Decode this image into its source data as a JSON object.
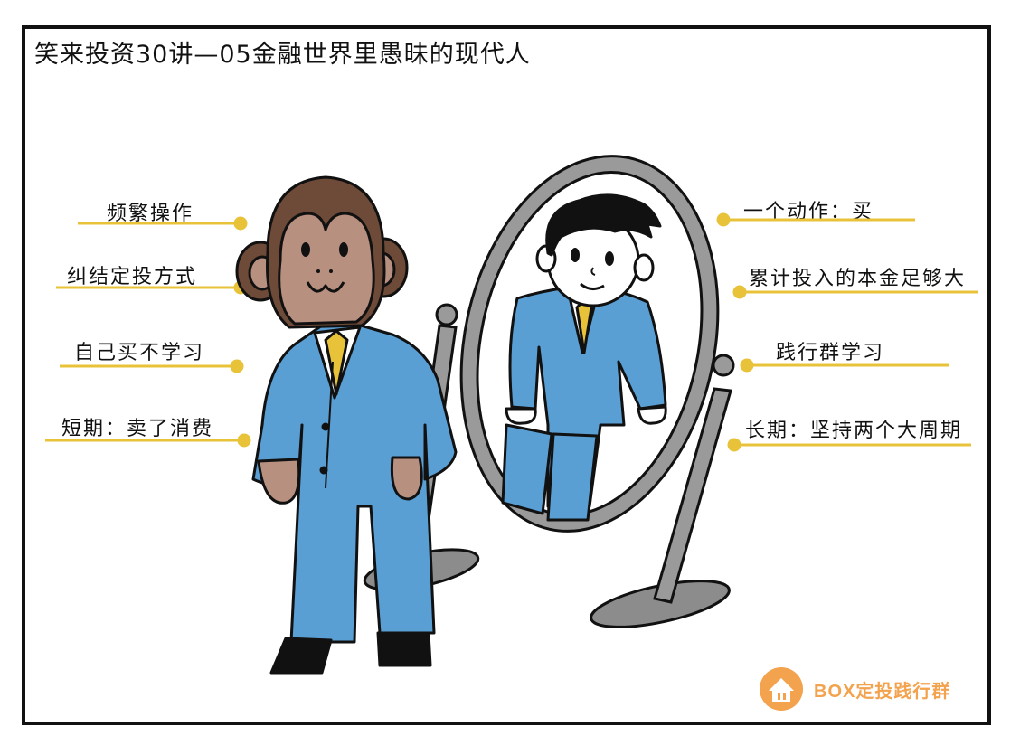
{
  "title": "笑来投资30讲—05金融世界里愚昧的现代人",
  "left_labels": [
    "频繁操作",
    "纠结定投方式",
    "自己买不学习",
    "短期：卖了消费"
  ],
  "right_labels": [
    "一个动作：买",
    "累计投入的本金足够大",
    "践行群学习",
    "长期：坚持两个大周期"
  ],
  "brand": {
    "text": "BOX定投践行群",
    "color": "#f3a24d"
  },
  "colors": {
    "suit": "#5a9fd4",
    "monkey_fur": "#6e4a38",
    "monkey_face": "#b89080",
    "underline": "#e8c33a",
    "mirror_frame": "#9a9a9a"
  }
}
